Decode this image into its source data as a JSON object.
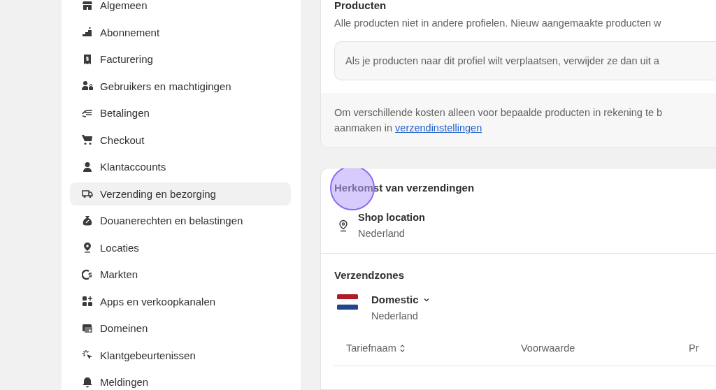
{
  "sidebar": {
    "items": [
      {
        "label": "Algemeen",
        "selected": false
      },
      {
        "label": "Abonnement",
        "selected": false
      },
      {
        "label": "Facturering",
        "selected": false
      },
      {
        "label": "Gebruikers en machtigingen",
        "selected": false
      },
      {
        "label": "Betalingen",
        "selected": false
      },
      {
        "label": "Checkout",
        "selected": false
      },
      {
        "label": "Klantaccounts",
        "selected": false
      },
      {
        "label": "Verzending en bezorging",
        "selected": true
      },
      {
        "label": "Douanerechten en belastingen",
        "selected": false
      },
      {
        "label": "Locaties",
        "selected": false
      },
      {
        "label": "Markten",
        "selected": false
      },
      {
        "label": "Apps en verkoopkanalen",
        "selected": false
      },
      {
        "label": "Domeinen",
        "selected": false
      },
      {
        "label": "Klantgebeurtenissen",
        "selected": false
      },
      {
        "label": "Meldingen",
        "selected": false
      }
    ]
  },
  "products": {
    "title": "Producten",
    "description": "Alle producten niet in andere profielen. Nieuw aangemaakte producten w",
    "notice": "Als je producten naar dit profiel wilt verplaatsen, verwijder ze dan uit a",
    "footer_text": "Om verschillende kosten alleen voor bepaalde producten in rekening te b",
    "footer_text_2": "aanmaken in",
    "footer_link": "verzendinstellingen"
  },
  "origin": {
    "title": "Herkomst van verzendingen",
    "location_name": "Shop location",
    "location_country": "Nederland"
  },
  "zones": {
    "title": "Verzendzones",
    "zone_name": "Domestic",
    "expanded": false,
    "zone_country": "Nederland",
    "columns": [
      "Tariefnaam",
      "Voorwaarde",
      "Pr"
    ]
  }
}
